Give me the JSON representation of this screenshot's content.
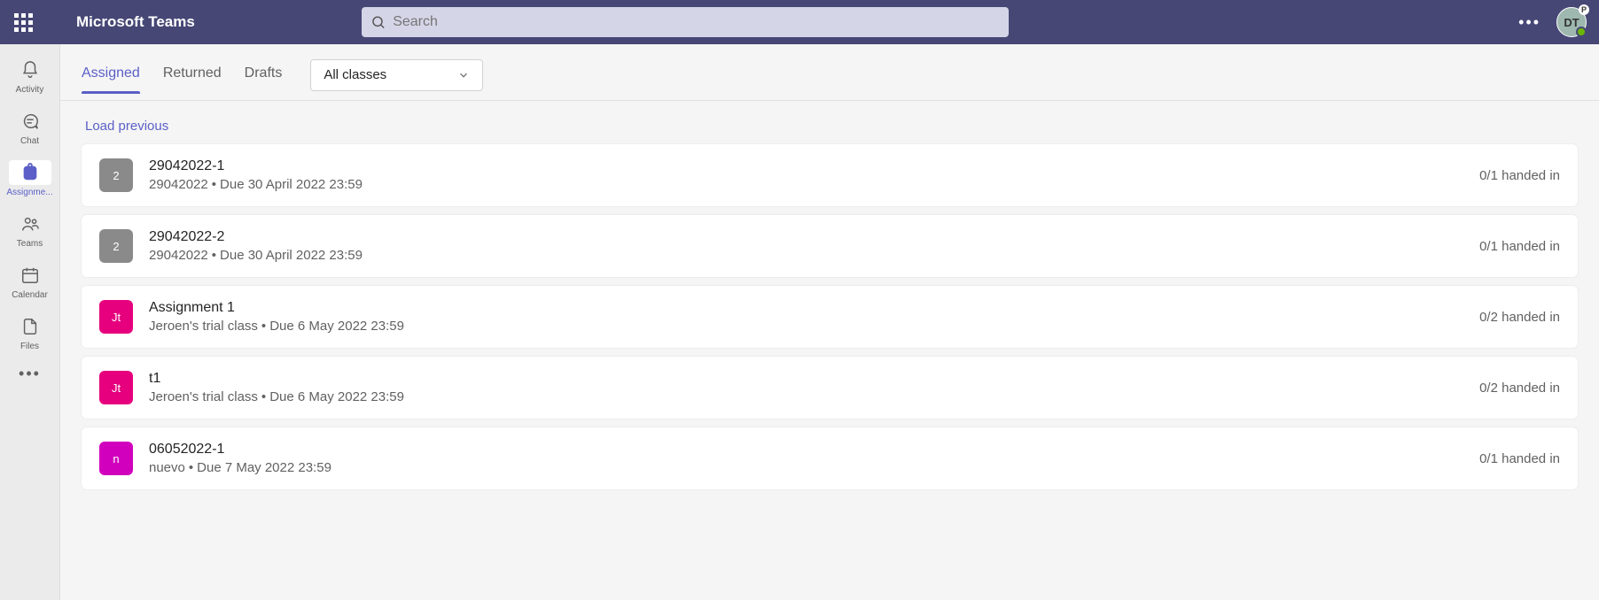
{
  "header": {
    "app_title": "Microsoft Teams",
    "search_placeholder": "Search",
    "avatar_initials": "DT",
    "plan_badge": "P"
  },
  "rail": {
    "items": [
      {
        "key": "activity",
        "label": "Activity"
      },
      {
        "key": "chat",
        "label": "Chat"
      },
      {
        "key": "assignments",
        "label": "Assignme..."
      },
      {
        "key": "teams",
        "label": "Teams"
      },
      {
        "key": "calendar",
        "label": "Calendar"
      },
      {
        "key": "files",
        "label": "Files"
      }
    ]
  },
  "tabs": {
    "items": [
      {
        "key": "assigned",
        "label": "Assigned"
      },
      {
        "key": "returned",
        "label": "Returned"
      },
      {
        "key": "drafts",
        "label": "Drafts"
      }
    ],
    "class_filter": "All classes"
  },
  "list": {
    "load_previous": "Load previous",
    "assignments": [
      {
        "thumb_text": "2",
        "thumb_color": "grey",
        "title": "29042022-1",
        "class": "29042022",
        "due": "Due 30 April 2022 23:59",
        "status": "0/1 handed in"
      },
      {
        "thumb_text": "2",
        "thumb_color": "grey",
        "title": "29042022-2",
        "class": "29042022",
        "due": "Due 30 April 2022 23:59",
        "status": "0/1 handed in"
      },
      {
        "thumb_text": "Jt",
        "thumb_color": "pink",
        "title": "Assignment 1",
        "class": "Jeroen's trial class",
        "due": "Due 6 May 2022 23:59",
        "status": "0/2 handed in"
      },
      {
        "thumb_text": "Jt",
        "thumb_color": "pink",
        "title": "t1",
        "class": "Jeroen's trial class",
        "due": "Due 6 May 2022 23:59",
        "status": "0/2 handed in"
      },
      {
        "thumb_text": "n",
        "thumb_color": "magenta",
        "title": "06052022-1",
        "class": "nuevo",
        "due": "Due 7 May 2022 23:59",
        "status": "0/1 handed in"
      }
    ]
  }
}
